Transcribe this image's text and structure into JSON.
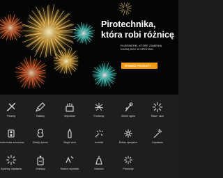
{
  "hero": {
    "title": "Pirotechnika,\nktóra robi różnicę",
    "subtitle": "FAJERWERKI, KTÓRE ZAMIENIĄ\nKAŻDĄ NOC W SPEKTAKL",
    "button_label": "SPRAWDŹ PRODUKTY →"
  },
  "categories": [
    {
      "label": "Petardy",
      "icon": "firecracker-icon"
    },
    {
      "label": "Rakiety",
      "icon": "rocket-icon"
    },
    {
      "label": "Wyrzutnie",
      "icon": "launcher-icon"
    },
    {
      "label": "Fontanny",
      "icon": "fountain-icon"
    },
    {
      "label": "Zimne ognie",
      "icon": "sparkler-icon"
    },
    {
      "label": "Race i race",
      "icon": "flare-icon"
    },
    {
      "label": "Pirotechnika sceniczna",
      "icon": "stage-pyro-icon"
    },
    {
      "label": "Efekty dymne",
      "icon": "smoke-icon"
    },
    {
      "label": "Single shot",
      "icon": "single-shot-icon"
    },
    {
      "label": "Konfetti",
      "icon": "confetti-icon"
    },
    {
      "label": "Efekty specjalne",
      "icon": "special-effects-icon"
    },
    {
      "label": "Odpalanie",
      "icon": "ignition-icon"
    },
    {
      "label": "Systemy odpalania",
      "icon": "firing-system-icon"
    },
    {
      "label": "Zestawy",
      "icon": "set-icon"
    },
    {
      "label": "Świece rzymskie",
      "icon": "roman-candle-icon"
    },
    {
      "label": "Nowości",
      "icon": "new-icon"
    },
    {
      "label": "Promocje",
      "icon": "promo-icon"
    }
  ],
  "colors": {
    "accent": "#f39c12",
    "background": "#1e1e1e",
    "hero_bg": "#050505"
  }
}
